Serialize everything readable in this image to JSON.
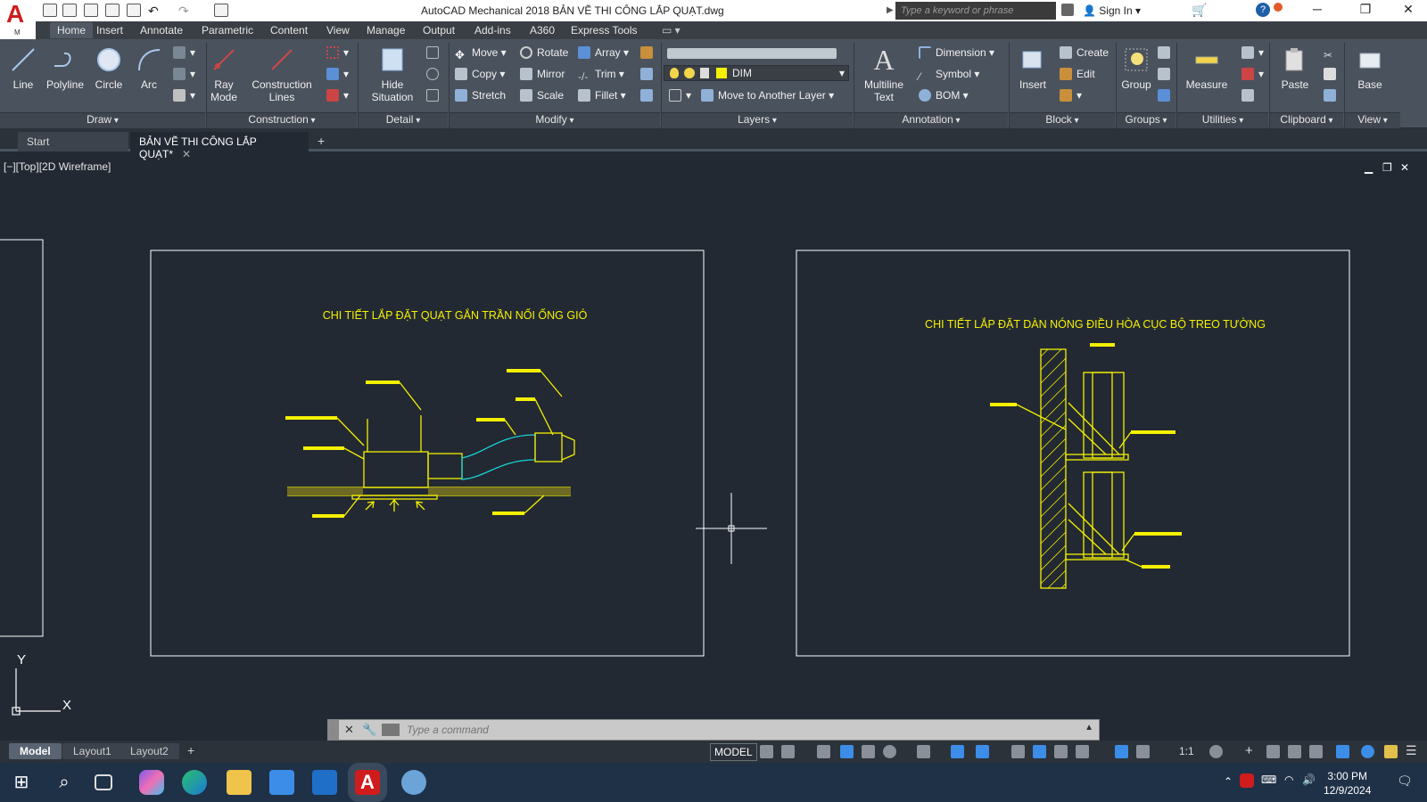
{
  "window": {
    "title": "AutoCAD Mechanical 2018    BẢN VẼ THI CÔNG LẮP QUẠT.dwg",
    "search_placeholder": "Type a keyword or phrase",
    "sign_in": "Sign In",
    "app_letter": "A",
    "app_sub": "M"
  },
  "ribbon_tabs": [
    "Home",
    "Insert",
    "Annotate",
    "Parametric",
    "Content",
    "View",
    "Manage",
    "Output",
    "Add-ins",
    "A360",
    "Express Tools"
  ],
  "ribbon": {
    "draw": {
      "line": "Line",
      "polyline": "Polyline",
      "circle": "Circle",
      "arc": "Arc",
      "label": "Draw"
    },
    "construction": {
      "ray_1": "Ray",
      "ray_2": "Mode",
      "lines_1": "Construction",
      "lines_2": "Lines",
      "label": "Construction"
    },
    "detail": {
      "hide_1": "Hide",
      "hide_2": "Situation",
      "label": "Detail"
    },
    "modify": {
      "move": "Move",
      "rotate": "Rotate",
      "array": "Array",
      "copy": "Copy",
      "mirror": "Mirror",
      "trim": "Trim",
      "stretch": "Stretch",
      "scale": "Scale",
      "fillet": "Fillet",
      "label": "Modify"
    },
    "layers": {
      "current_layer": "DIM",
      "move_to_layer": "Move to Another Layer",
      "label": "Layers"
    },
    "annotation": {
      "mtext_1": "Multiline",
      "mtext_2": "Text",
      "dimension": "Dimension",
      "symbol": "Symbol",
      "bom": "BOM",
      "label": "Annotation"
    },
    "block": {
      "insert": "Insert",
      "create": "Create",
      "edit": "Edit",
      "label": "Block"
    },
    "groups": {
      "group": "Group",
      "label": "Groups"
    },
    "utilities": {
      "measure": "Measure",
      "label": "Utilities"
    },
    "clipboard": {
      "paste": "Paste",
      "label": "Clipboard"
    },
    "view": {
      "base": "Base",
      "label": "View"
    }
  },
  "doc_tabs": {
    "start": "Start",
    "active": "BẢN VẼ THI CÔNG LẮP QUẠT*"
  },
  "viewport": {
    "label": "[−][Top][2D Wireframe]"
  },
  "drawing": {
    "title_left": "CHI TIẾT LẮP ĐẶT QUẠT GẮN TRẦN NỐI ỐNG GIÓ",
    "title_right": "CHI TIẾT LẮP ĐẶT DÀN NÓNG ĐIỀU HÒA CỤC BỘ TREO TƯỜNG",
    "ucs_y": "Y",
    "ucs_x": "X"
  },
  "command": {
    "placeholder": "Type a command"
  },
  "layout_tabs": [
    "Model",
    "Layout1",
    "Layout2"
  ],
  "status": {
    "model": "MODEL",
    "scale": "1:1"
  },
  "taskbar": {
    "time": "3:00 PM",
    "date": "12/9/2024"
  },
  "colors": {
    "accent_yellow": "#f5f000",
    "ribbon": "#4a525d",
    "canvas": "#222933"
  }
}
